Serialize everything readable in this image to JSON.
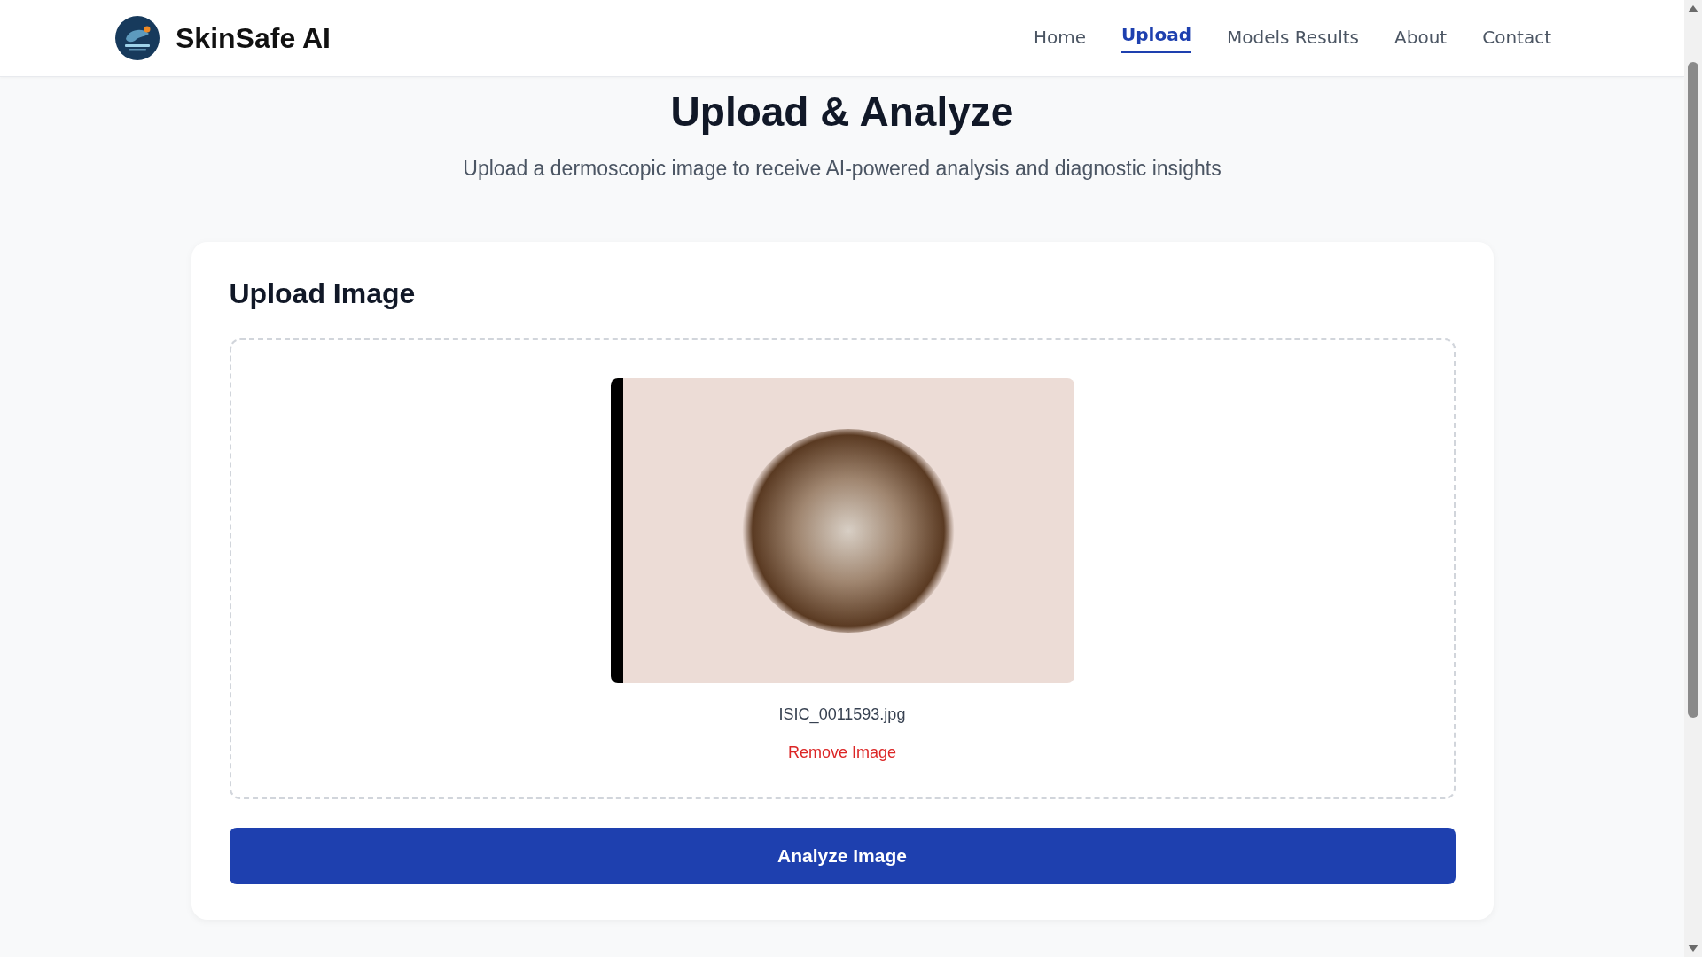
{
  "brand": {
    "name": "SkinSafe AI"
  },
  "nav": [
    {
      "label": "Home",
      "selected": false
    },
    {
      "label": "Upload",
      "selected": true
    },
    {
      "label": "Models Results",
      "selected": false
    },
    {
      "label": "About",
      "selected": false
    },
    {
      "label": "Contact",
      "selected": false
    }
  ],
  "hero": {
    "title": "Upload & Analyze",
    "subtitle": "Upload a dermoscopic image to receive AI-powered analysis and diagnostic insights"
  },
  "card": {
    "title": "Upload Image",
    "file_name": "ISIC_0011593.jpg",
    "remove_label": "Remove Image",
    "button": "Analyze Image"
  }
}
